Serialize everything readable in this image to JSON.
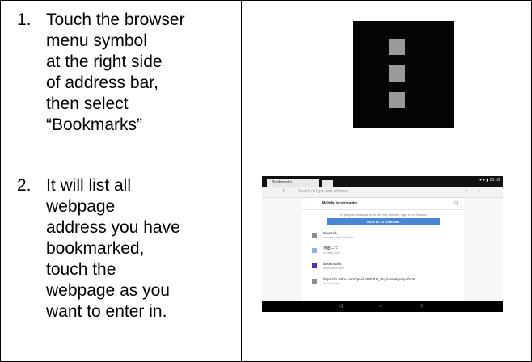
{
  "steps": [
    {
      "number": "1.",
      "text": "Touch the browser\nmenu symbol\nat the right side\nof address bar,\nthen select\n“Bookmarks”"
    },
    {
      "number": "2.",
      "text": " It will list all\nwebpage\naddress you have\nbookmarked,\ntouch the\nwebpage as you\nwant to enter in."
    }
  ],
  "screenshot": {
    "tab_label": "Bookmarks",
    "status_text": "♥ ▾ ▮ 10:10",
    "nav_icons": "← → C",
    "address_placeholder": "Search or type web address",
    "address_actions": "☆ ⇩ ⋮",
    "header_back": "←",
    "header_title": "Mobile bookmarks",
    "header_search": "Q",
    "sync_message": "To get your bookmarks on all your devices, sign in to Chrome.",
    "signin_button": "SIGN IN TO CHROME",
    "bookmarks": [
      {
        "title": "New tab",
        "url": "chrome-native://newtab/",
        "icon_color": "#8c8c8c"
      },
      {
        "title": "百度一下",
        "url": "m.baidu.com",
        "icon_color": "#8fb0e8"
      },
      {
        "title": "Bookmarks",
        "url": "www.yahoo.com",
        "icon_color": "#5a2fa8"
      },
      {
        "title": "https://m.sohu.com/?pvid=000115_3w_index&jump=front",
        "url": "m.sohu.com",
        "icon_color": "#8c8c8c"
      }
    ],
    "more_icon": "⋮",
    "nav_back": "◁",
    "nav_home": "○",
    "nav_recent": "□"
  }
}
